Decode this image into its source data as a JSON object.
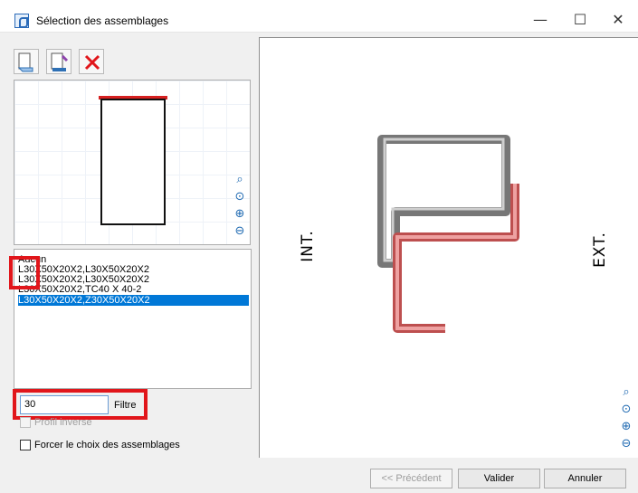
{
  "window": {
    "title": "Sélection des assemblages",
    "minimize": "—",
    "maximize": "☐",
    "close": "✕"
  },
  "toolbar": {
    "icons": [
      "add-assembly-icon",
      "edit-assembly-icon",
      "delete-icon"
    ],
    "delete_color": "#e1161b"
  },
  "assemblies": [
    "Aucun",
    "L30X50X20X2,L30X50X20X2",
    "L30X50X20X2,L30X50X20X2",
    "L30X50X20X2,TC40 X 40-2",
    "L30X50X20X2,Z30X50X20X2"
  ],
  "filter": {
    "value": "30",
    "label": "Filtre"
  },
  "options": {
    "profile_inverse": "Profil inverse",
    "force_choice": "Forcer le choix des assemblages"
  },
  "drawing": {
    "interior_label": "INT.",
    "exterior_label": "EXT.",
    "gray_profile_color": "#777777",
    "red_profile_color": "#e57373"
  },
  "footer": {
    "previous": "<< Précédent",
    "validate": "Valider",
    "cancel": "Annuler"
  }
}
